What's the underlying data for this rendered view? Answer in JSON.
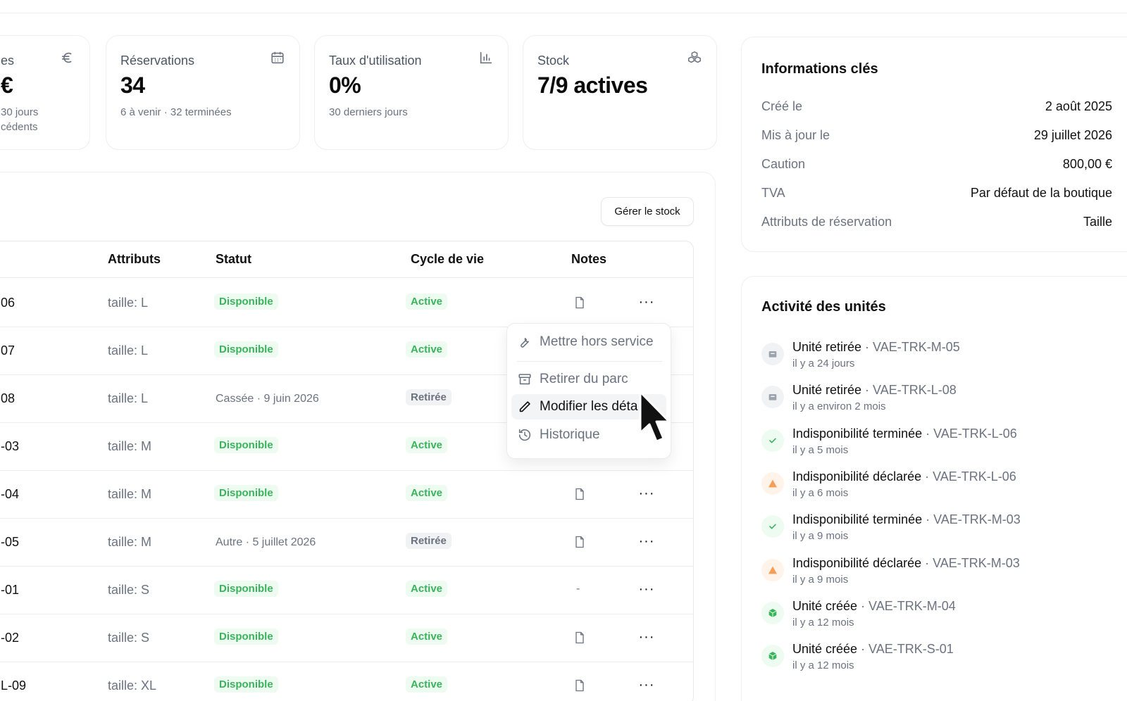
{
  "stats": [
    {
      "title": "es",
      "value": "€",
      "sub1": "30 jours",
      "sub2": "cédents",
      "icon": "euro-icon"
    },
    {
      "title": "Réservations",
      "value": "34",
      "sub1": "6 à venir · 32 terminées",
      "icon": "calendar-icon"
    },
    {
      "title": "Taux d'utilisation",
      "value": "0%",
      "sub1": "30 derniers jours",
      "icon": "bar-chart-icon"
    },
    {
      "title": "Stock",
      "value": "7/9 actives",
      "icon": "boxes-icon"
    }
  ],
  "units": {
    "manage_stock_label": "Gérer le stock",
    "columns": {
      "attributes": "Attributs",
      "status": "Statut",
      "lifecycle": "Cycle de vie",
      "notes": "Notes"
    },
    "rows": [
      {
        "id": "06",
        "attr": "taille: L",
        "status": "Disponible",
        "lifecycle": "Active",
        "note": "doc",
        "more": "···"
      },
      {
        "id": "07",
        "attr": "taille: L",
        "status": "Disponible",
        "lifecycle": "Active",
        "note": "",
        "more": ""
      },
      {
        "id": "08",
        "attr": "taille: L",
        "status": "Cassée · 9 juin 2026",
        "lifecycle": "Retirée",
        "note": "",
        "more": ""
      },
      {
        "id": "-03",
        "attr": "taille: M",
        "status": "Disponible",
        "lifecycle": "Active",
        "note": "",
        "more": ""
      },
      {
        "id": "-04",
        "attr": "taille: M",
        "status": "Disponible",
        "lifecycle": "Active",
        "note": "doc",
        "more": "···"
      },
      {
        "id": "-05",
        "attr": "taille: M",
        "status": "Autre · 5 juillet 2026",
        "lifecycle": "Retirée",
        "note": "doc",
        "more": "···"
      },
      {
        "id": "-01",
        "attr": "taille: S",
        "status": "Disponible",
        "lifecycle": "Active",
        "note": "-",
        "more": "···"
      },
      {
        "id": "-02",
        "attr": "taille: S",
        "status": "Disponible",
        "lifecycle": "Active",
        "note": "doc",
        "more": "···"
      },
      {
        "id": "L-09",
        "attr": "taille: XL",
        "status": "Disponible",
        "lifecycle": "Active",
        "note": "doc",
        "more": "···"
      }
    ]
  },
  "context_menu": {
    "items": [
      {
        "label": "Mettre hors service",
        "icon": "wrench-icon"
      },
      {
        "label": "Retirer du parc",
        "icon": "archive-icon"
      },
      {
        "label": "Modifier les déta",
        "icon": "pencil-icon"
      },
      {
        "label": "Historique",
        "icon": "history-icon"
      }
    ]
  },
  "key_info": {
    "title": "Informations clés",
    "rows": [
      {
        "label": "Créé le",
        "value": "2 août 2025"
      },
      {
        "label": "Mis à jour le",
        "value": "29 juillet 2026"
      },
      {
        "label": "Caution",
        "value": "800,00 €"
      },
      {
        "label": "TVA",
        "value": "Par défaut de la boutique"
      },
      {
        "label": "Attributs de réservation",
        "value": "Taille"
      }
    ]
  },
  "activity": {
    "title": "Activité des unités",
    "items": [
      {
        "event": "Unité retirée",
        "unit": " · VAE-TRK-M-05",
        "time": "il y a 24 jours",
        "kind": "retired",
        "icon": "archive-icon"
      },
      {
        "event": "Unité retirée",
        "unit": " · VAE-TRK-L-08",
        "time": "il y a environ 2 mois",
        "kind": "retired",
        "icon": "archive-icon"
      },
      {
        "event": "Indisponibilité terminée",
        "unit": " · VAE-TRK-L-06",
        "time": "il y a 5 mois",
        "kind": "ok",
        "icon": "check-icon"
      },
      {
        "event": "Indisponibilité déclarée",
        "unit": " · VAE-TRK-L-06",
        "time": "il y a 6 mois",
        "kind": "warn",
        "icon": "warning-icon"
      },
      {
        "event": "Indisponibilité terminée",
        "unit": " · VAE-TRK-M-03",
        "time": "il y a 9 mois",
        "kind": "ok",
        "icon": "check-icon"
      },
      {
        "event": "Indisponibilité déclarée",
        "unit": " · VAE-TRK-M-03",
        "time": "il y a 9 mois",
        "kind": "warn",
        "icon": "warning-icon"
      },
      {
        "event": "Unité créée",
        "unit": " · VAE-TRK-M-04",
        "time": "il y a 12 mois",
        "kind": "created",
        "icon": "box-icon"
      },
      {
        "event": "Unité créée",
        "unit": " · VAE-TRK-S-01",
        "time": "il y a 12 mois",
        "kind": "created",
        "icon": "box-icon"
      }
    ]
  },
  "colors": {
    "green": "#3ab45c",
    "green_bg": "#eefbf1",
    "warn": "#f59e58",
    "warn_bg": "#fff3ea",
    "gray_bg": "#f1f2f3"
  }
}
